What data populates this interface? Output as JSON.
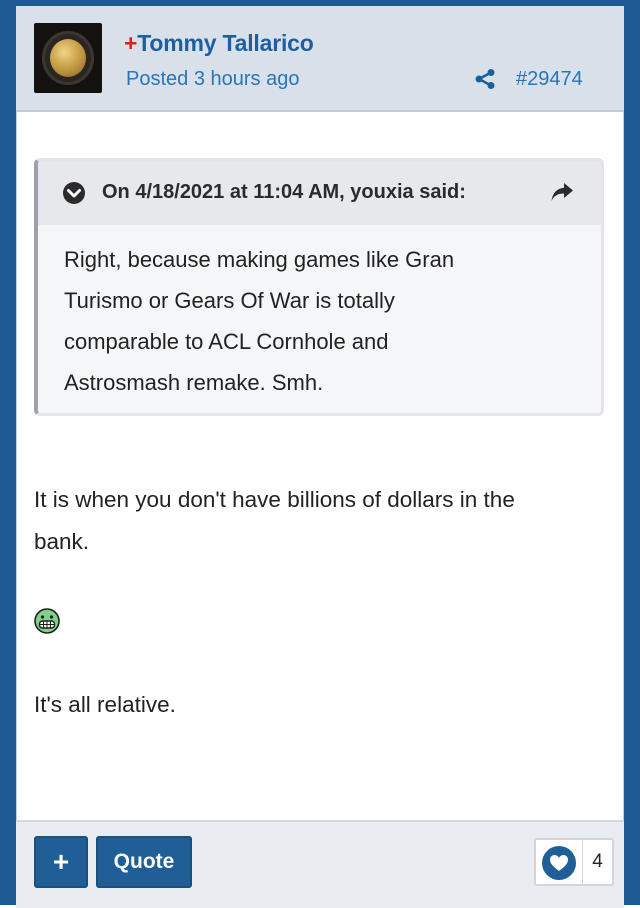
{
  "post": {
    "author_prefix": "+",
    "author_name": "Tommy Tallarico",
    "posted": "Posted 3 hours ago",
    "post_number": "#29474"
  },
  "quote": {
    "citation": "On 4/18/2021 at 11:04 AM, youxia said:",
    "lines": [
      "Right, because making games like Gran",
      "Turismo or Gears Of War is totally",
      "comparable to ACL Cornhole and",
      "Astrosmash remake. Smh."
    ]
  },
  "body": {
    "line1": "It is when you don't have billions of dollars in the",
    "line2": "bank.",
    "line3": "It's all relative."
  },
  "footer": {
    "plus_label": "+",
    "quote_label": "Quote",
    "like_count": "4"
  },
  "icons": {
    "share": "share-icon",
    "chevron": "chevron-down-icon",
    "reply": "reply-arrow-icon",
    "emoji": "grinning-face-icon",
    "heart": "heart-icon"
  },
  "colors": {
    "accent": "#1f5e96",
    "author_prefix": "#e02020",
    "link": "#2a74b8"
  }
}
